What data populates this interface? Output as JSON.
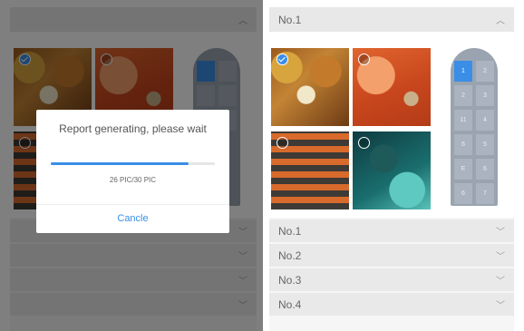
{
  "left": {
    "header": {
      "title": "",
      "chevron": "chevron-up-icon"
    }
  },
  "right": {
    "header": {
      "title": "No.1",
      "chevron": "chevron-up-icon"
    },
    "grid_labels": [
      "1",
      "2",
      "2",
      "3",
      "11",
      "4",
      "6",
      "5",
      "E",
      "6",
      "6",
      "7"
    ],
    "rows": [
      {
        "label": "No.1"
      },
      {
        "label": "No.2"
      },
      {
        "label": "No.3"
      },
      {
        "label": "No.4"
      }
    ]
  },
  "dialog": {
    "title": "Report generating, please wait",
    "progress": 0.84,
    "count": "26 PIC/30 PIC",
    "cancel": "Cancle"
  },
  "colors": {
    "accent": "#3a8ee6"
  }
}
